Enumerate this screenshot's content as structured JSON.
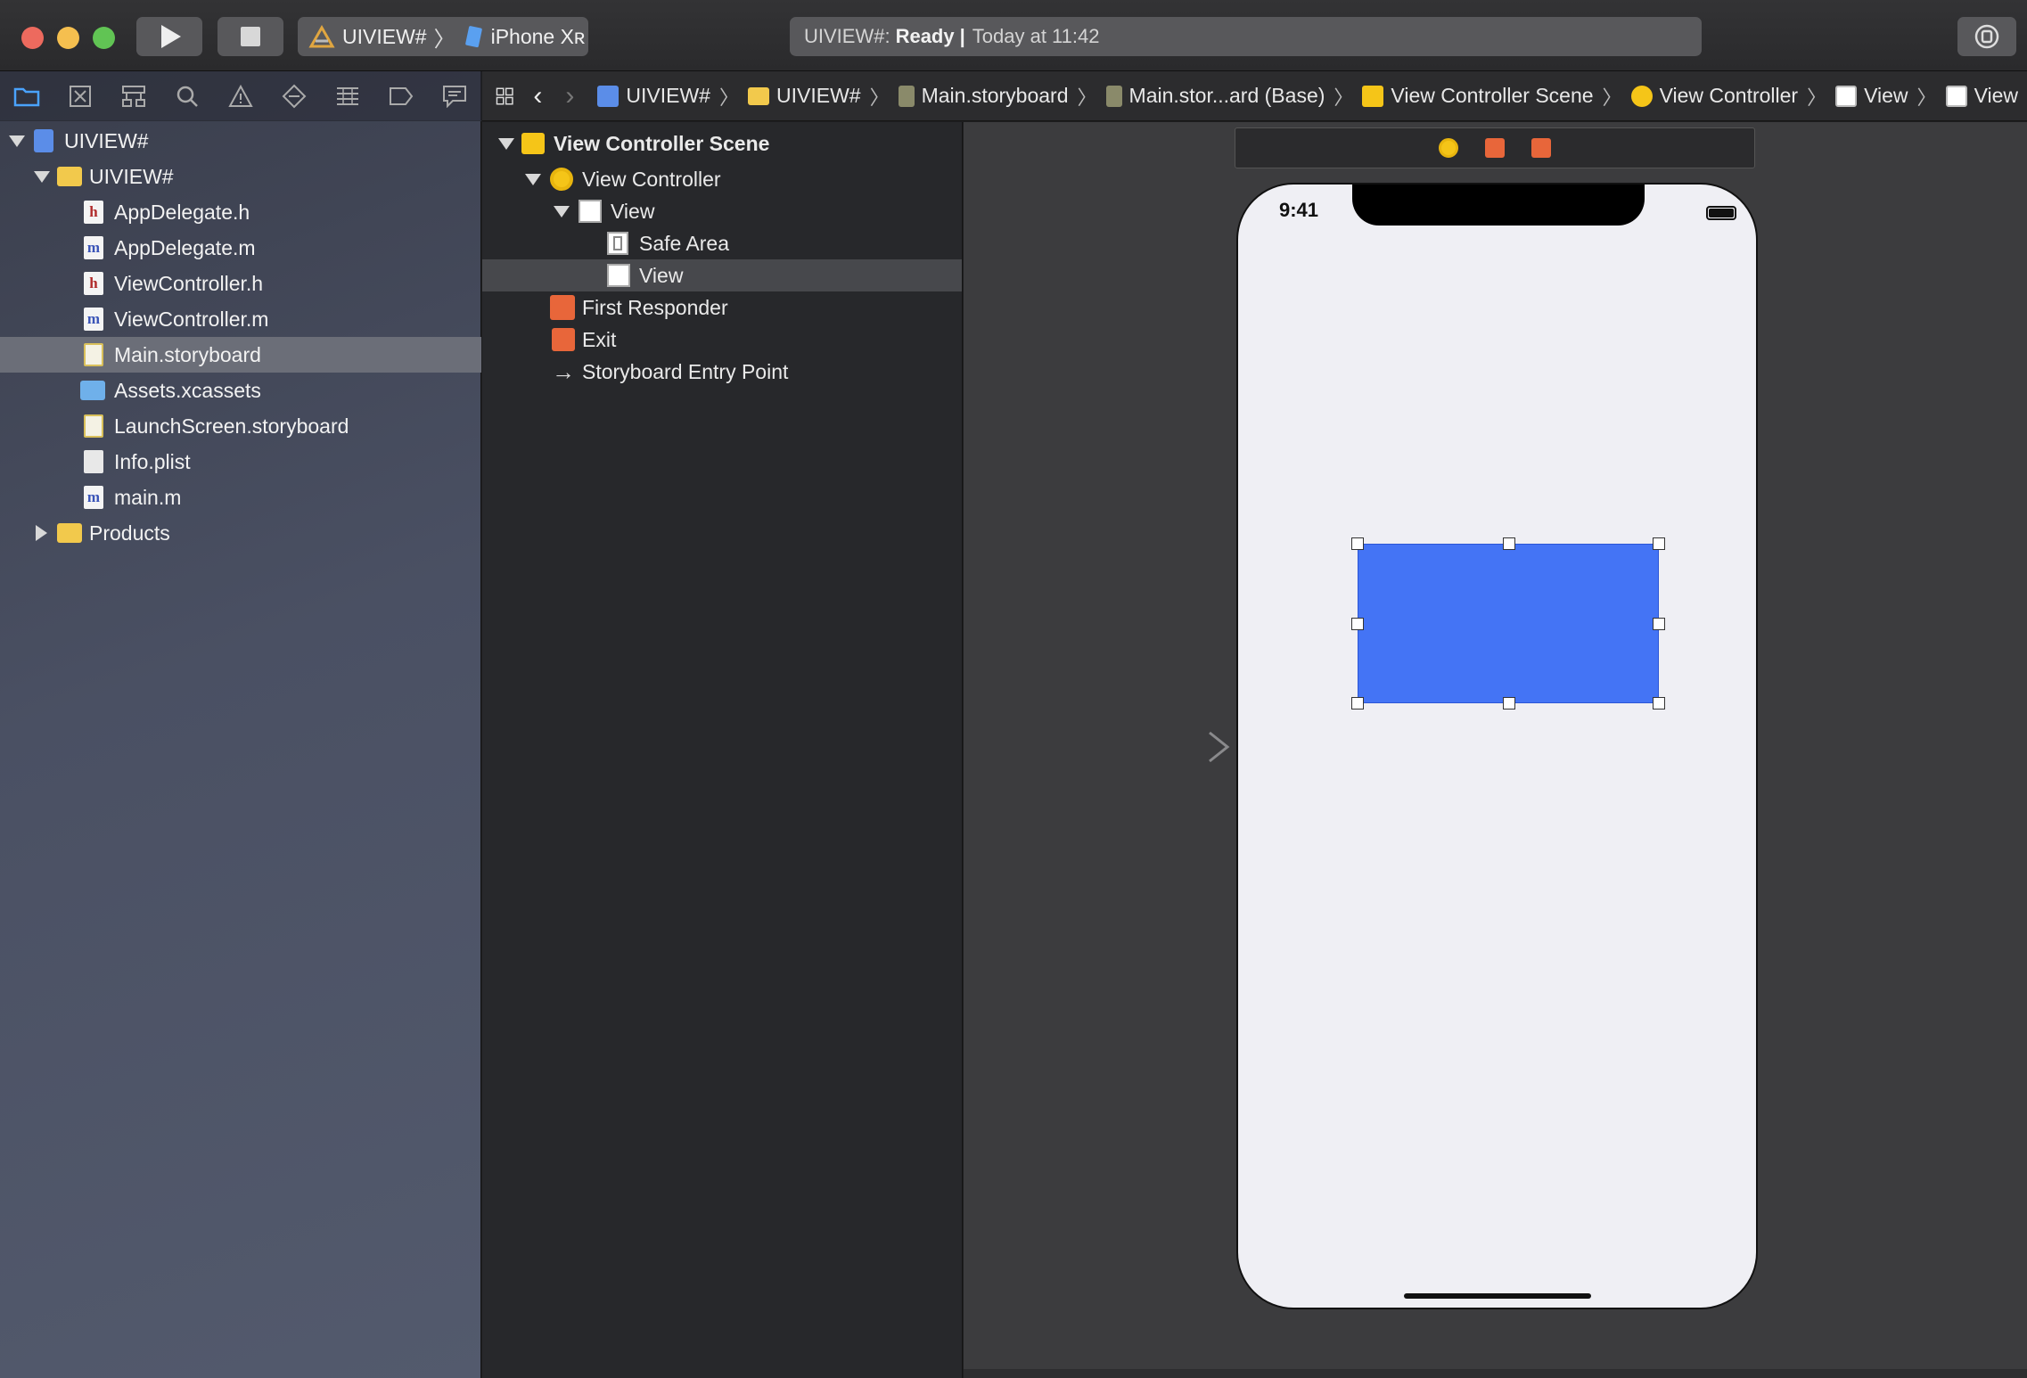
{
  "toolbar": {
    "scheme_target": "UIVIEW#",
    "scheme_device": "iPhone Xʀ",
    "status_project": "UIVIEW#:",
    "status_state": "Ready",
    "status_separator": "|",
    "status_time": "Today at 11:42"
  },
  "navigator": {
    "tabs": [
      "folder-icon",
      "x-square-icon",
      "hierarchy-icon",
      "search-icon",
      "warning-icon",
      "test-icon",
      "debug-icon",
      "breakpoint-icon",
      "report-icon"
    ],
    "tree": [
      {
        "label": "UIVIEW#",
        "kind": "project"
      },
      {
        "label": "UIVIEW#",
        "kind": "folder"
      },
      {
        "label": "AppDelegate.h",
        "kind": "h"
      },
      {
        "label": "AppDelegate.m",
        "kind": "m"
      },
      {
        "label": "ViewController.h",
        "kind": "h"
      },
      {
        "label": "ViewController.m",
        "kind": "m"
      },
      {
        "label": "Main.storyboard",
        "kind": "storyboard"
      },
      {
        "label": "Assets.xcassets",
        "kind": "assets"
      },
      {
        "label": "LaunchScreen.storyboard",
        "kind": "storyboard"
      },
      {
        "label": "Info.plist",
        "kind": "plist"
      },
      {
        "label": "main.m",
        "kind": "m"
      },
      {
        "label": "Products",
        "kind": "folder"
      }
    ],
    "file_icon_letters": {
      "h": "h",
      "m": "m"
    },
    "selected": "Main.storyboard"
  },
  "jumpbar": {
    "items": [
      "UIVIEW#",
      "UIVIEW#",
      "Main.storyboard",
      "Main.stor...ard (Base)",
      "View Controller Scene",
      "View Controller",
      "View",
      "View"
    ]
  },
  "outline": {
    "scene": "View Controller Scene",
    "view_controller": "View Controller",
    "view": "View",
    "safe_area": "Safe Area",
    "subview": "View",
    "first_responder": "First Responder",
    "exit": "Exit",
    "entry_point": "Storyboard Entry Point",
    "entry_arrow_glyph": "→"
  },
  "canvas": {
    "status_time": "9:41",
    "subview_color": "#4474f5"
  },
  "colors": {
    "accent_yellow": "#f5c518",
    "accent_orange": "#e8663a",
    "selection": "#6b6e78"
  }
}
